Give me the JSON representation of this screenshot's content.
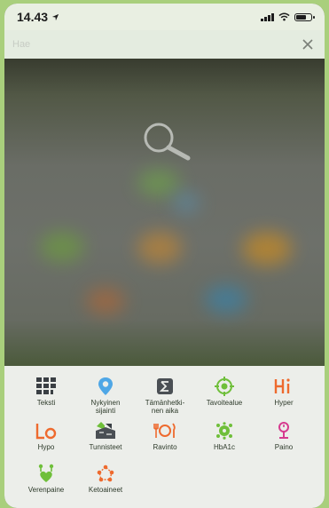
{
  "status_bar": {
    "time": "14.43"
  },
  "search": {
    "placeholder": "Hae"
  },
  "quick_items": [
    {
      "id": "teksti",
      "label": "Teksti",
      "icon": "text-grid-icon"
    },
    {
      "id": "nykyinen-sijainti",
      "label": "Nykyinen\nsijainti",
      "icon": "location-pin-icon"
    },
    {
      "id": "tamanhetkinen-aika",
      "label": "Tämänhetki-\nnen aika",
      "icon": "sigma-clock-icon"
    },
    {
      "id": "tavoitealue",
      "label": "Tavoitealue",
      "icon": "target-icon"
    },
    {
      "id": "hyper",
      "label": "Hyper",
      "icon": "hi-icon"
    },
    {
      "id": "hypo",
      "label": "Hypo",
      "icon": "lo-icon"
    },
    {
      "id": "tunnisteet",
      "label": "Tunnisteet",
      "icon": "tags-icon"
    },
    {
      "id": "ravinto",
      "label": "Ravinto",
      "icon": "food-plate-icon"
    },
    {
      "id": "hba1c",
      "label": "HbA1c",
      "icon": "blood-cell-icon"
    },
    {
      "id": "paino",
      "label": "Paino",
      "icon": "scale-icon"
    },
    {
      "id": "verenpaine",
      "label": "Verenpaine",
      "icon": "blood-pressure-icon"
    },
    {
      "id": "ketoaineet",
      "label": "Ketoaineet",
      "icon": "ketone-icon"
    }
  ],
  "colors": {
    "accent_green": "#6fbf3a",
    "accent_orange": "#ee6a2e",
    "accent_blue": "#4fa7e6",
    "accent_magenta": "#d63b8f",
    "icon_dark": "#3a3f44"
  }
}
